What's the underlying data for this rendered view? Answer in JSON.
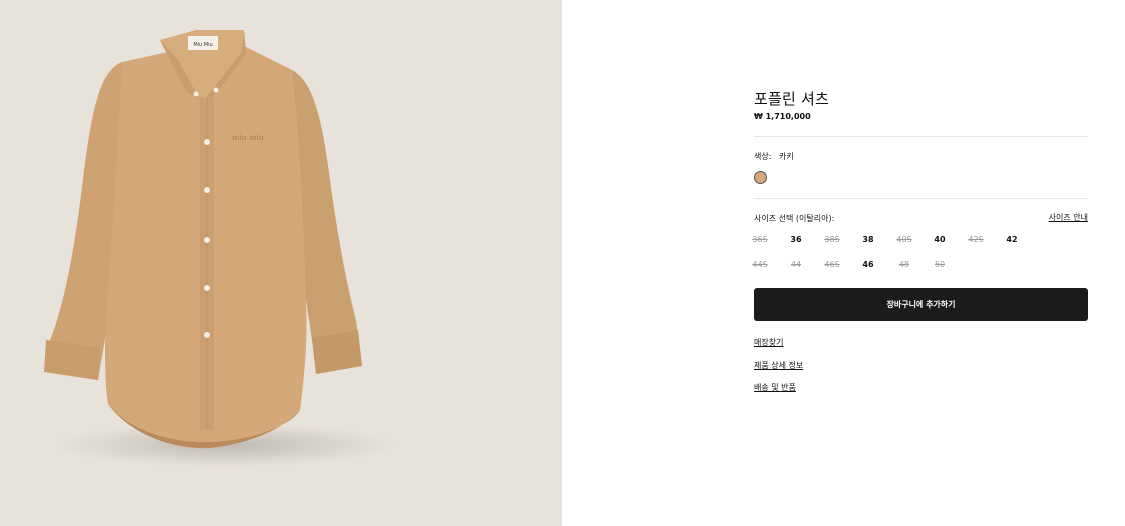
{
  "product": {
    "image_alt": "Miu Miu",
    "label_text": "Miu Miu",
    "embroidery_text": "miu miu",
    "title": "포플린 셔츠",
    "price": "₩ 1,710,000",
    "colors": {
      "shirt": "#d4a878",
      "shirt_shadow": "#b98a5c",
      "background": "#e8e3da"
    }
  },
  "color": {
    "label": "색상:",
    "value": "카키",
    "swatch_color": "#d4a878"
  },
  "size": {
    "label": "사이즈 선택 (이탈리아):",
    "guide_label": "사이즈 안내",
    "options": [
      {
        "label": "36S",
        "available": false
      },
      {
        "label": "36",
        "available": true
      },
      {
        "label": "38S",
        "available": false
      },
      {
        "label": "38",
        "available": true
      },
      {
        "label": "40S",
        "available": false
      },
      {
        "label": "40",
        "available": true
      },
      {
        "label": "42S",
        "available": false
      },
      {
        "label": "42",
        "available": true
      },
      {
        "label": "44S",
        "available": false
      },
      {
        "label": "44",
        "available": false
      },
      {
        "label": "46S",
        "available": false
      },
      {
        "label": "46",
        "available": true
      },
      {
        "label": "48",
        "available": false
      },
      {
        "label": "50",
        "available": false
      }
    ]
  },
  "actions": {
    "add_to_cart": "장바구니에 추가하기"
  },
  "links": {
    "find_store": "매장찾기",
    "product_details": "제품 상세 정보",
    "shipping_returns": "배송 및 반품"
  }
}
